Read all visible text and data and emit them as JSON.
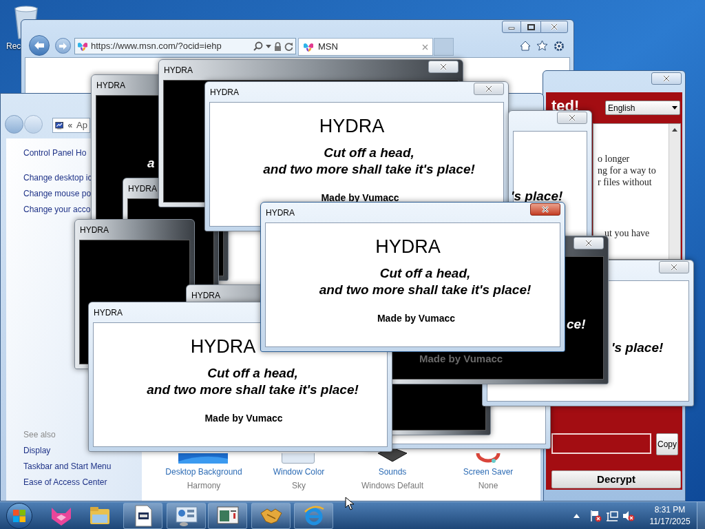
{
  "desktop": {
    "icons": [
      {
        "label": "Rec"
      }
    ]
  },
  "browser": {
    "url": "https://www.msn.com/?ocid=iehp",
    "tab": "MSN"
  },
  "ransom_window": {
    "heading": "ted!",
    "language": "English",
    "message_lines": [
      "o longer",
      "ng for a way to",
      "r files without",
      "ut you have"
    ],
    "copy_button": "Copy",
    "decrypt_button": "Decrypt"
  },
  "control_panel": {
    "breadcrumb_chevron": "«",
    "breadcrumb": "Ap",
    "task_links": [
      "Control Panel Ho",
      "Change desktop ic",
      "Change mouse po",
      "Change your acco"
    ],
    "see_also_heading": "See also",
    "see_also_links": [
      "Display",
      "Taskbar and Start Menu",
      "Ease of Access Center"
    ],
    "items": [
      {
        "label": "Desktop Background",
        "value": "Harmony"
      },
      {
        "label": "Window Color",
        "value": "Sky"
      },
      {
        "label": "Sounds",
        "value": "Windows Default"
      },
      {
        "label": "Screen Saver",
        "value": "None"
      }
    ]
  },
  "hydra_windows": [
    {
      "title": "HYDRA",
      "kind": "dark",
      "active": false,
      "texts": [
        {
          "kind": "fragment",
          "text": "a"
        }
      ]
    },
    {
      "title": "HYDRA",
      "kind": "dark",
      "active": false
    },
    {
      "title": "HYDRA",
      "kind": "dark",
      "active": false
    },
    {
      "title": "HYDRA",
      "kind": "dark",
      "active": false
    },
    {
      "title": "HYDRA",
      "kind": "dark",
      "active": false
    },
    {
      "title": "HYDRA",
      "kind": "light",
      "active": false,
      "texts": [
        {
          "kind": "heading",
          "text": "HYDRA"
        },
        {
          "kind": "line",
          "text": "Cut off a head,"
        },
        {
          "kind": "line",
          "text": "and two more shall take it's place!"
        },
        {
          "kind": "credit",
          "text": "Made by Vumacc"
        }
      ]
    },
    {
      "kind": "light",
      "active": false
    },
    {
      "kind": "dark",
      "active": false
    },
    {
      "kind": "light",
      "active": false,
      "texts": [
        {
          "kind": "fragment",
          "text": "'s place!"
        }
      ]
    },
    {
      "kind": "light",
      "active": false,
      "texts": [
        {
          "kind": "fragment",
          "text": "'s place!"
        }
      ]
    },
    {
      "kind": "dark",
      "active": false,
      "texts": [
        {
          "kind": "fragment",
          "text": "ce!"
        },
        {
          "kind": "faded",
          "text": "Made by Vumacc"
        }
      ]
    },
    {
      "title": "HYDRA",
      "kind": "light",
      "active": false,
      "texts": [
        {
          "kind": "heading",
          "text": "HYDRA"
        },
        {
          "kind": "line",
          "text": "Cut off a head,"
        },
        {
          "kind": "line",
          "text": "and two more shall take it's place!"
        },
        {
          "kind": "credit",
          "text": "Made by Vumacc"
        }
      ]
    },
    {
      "title": "HYDRA",
      "kind": "light",
      "active": true,
      "texts": [
        {
          "kind": "heading",
          "text": "HYDRA"
        },
        {
          "kind": "line",
          "text": "Cut off a head,"
        },
        {
          "kind": "line",
          "text": "and two more shall take it's place!"
        },
        {
          "kind": "credit",
          "text": "Made by Vumacc"
        }
      ]
    }
  ],
  "taskbar": {
    "time": "8:31 PM",
    "date": "11/17/2025"
  }
}
